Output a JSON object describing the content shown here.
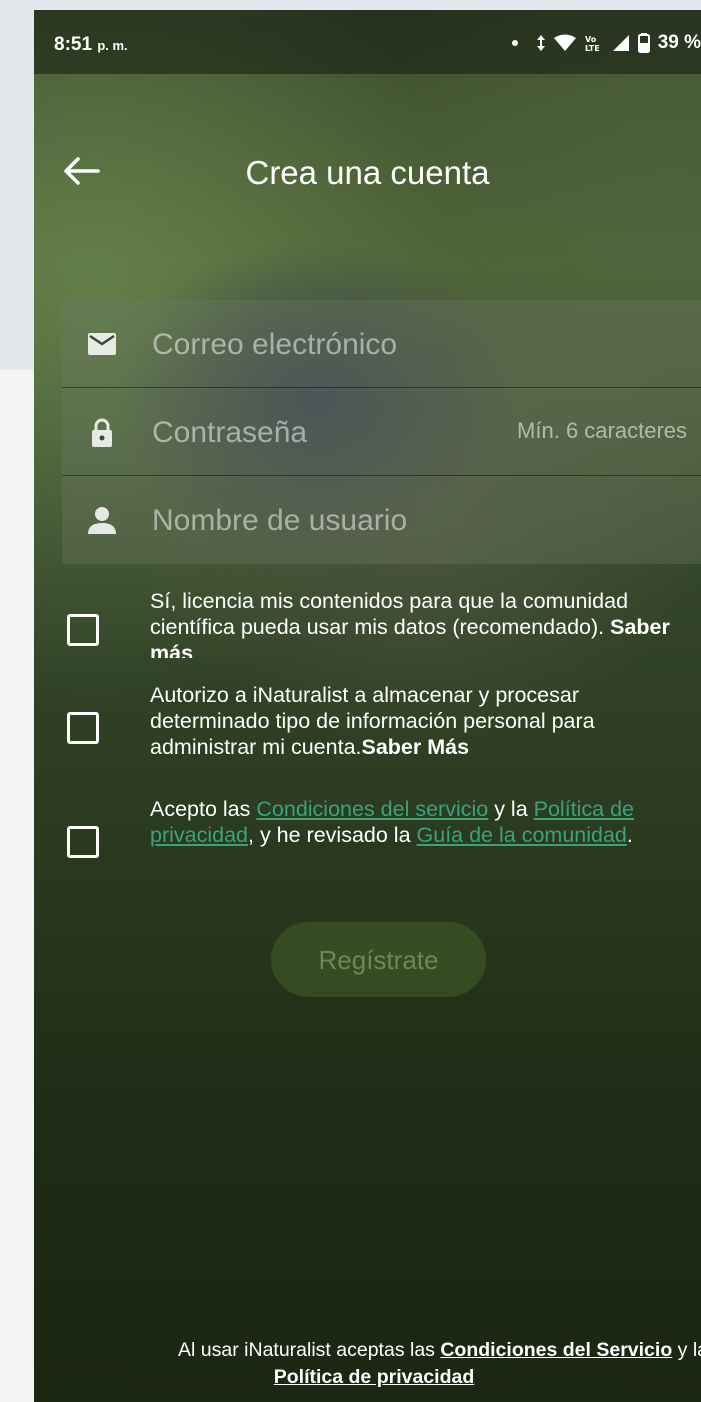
{
  "status_bar": {
    "time": "8:51",
    "period": "p. m.",
    "battery": "39 %",
    "icons": [
      "notification-dot-icon",
      "data-arrows-icon",
      "wifi-icon",
      "volte-icon",
      "signal-icon",
      "battery-icon"
    ]
  },
  "header": {
    "title": "Crea una cuenta",
    "back_icon": "back-arrow-icon"
  },
  "form": {
    "email_placeholder": "Correo electrónico",
    "password_placeholder": "Contraseña",
    "password_hint": "Mín. 6 caracteres",
    "username_placeholder": "Nombre de usuario"
  },
  "consents": {
    "license": {
      "text": "Sí, licencia mis contenidos para que la comunidad científica pueda usar mis datos (recomendado).",
      "learn_more": "Saber más",
      "checked": false
    },
    "personal_info": {
      "text": "Autorizo a iNaturalist a almacenar y procesar determinado tipo de información personal para administrar mi cuenta.",
      "learn_more": "Saber Más",
      "checked": false
    },
    "terms": {
      "prefix": "Acepto las ",
      "terms_link": "Condiciones del servicio",
      "middle": " y la ",
      "privacy_link": "Política de privacidad",
      "middle2": ", y he revisado la ",
      "guidelines_link": "Guía de la comunidad",
      "suffix": ".",
      "checked": false
    }
  },
  "register_button": "Regístrate",
  "footer": {
    "prefix": "Al usar iNaturalist aceptas las ",
    "terms_link": "Condiciones del Servicio",
    "middle": " y la",
    "privacy_link": "Política de privacidad"
  },
  "colors": {
    "link": "#3aa37d",
    "background_dark": "#2a3a1f",
    "button_disabled": "#465f28"
  }
}
